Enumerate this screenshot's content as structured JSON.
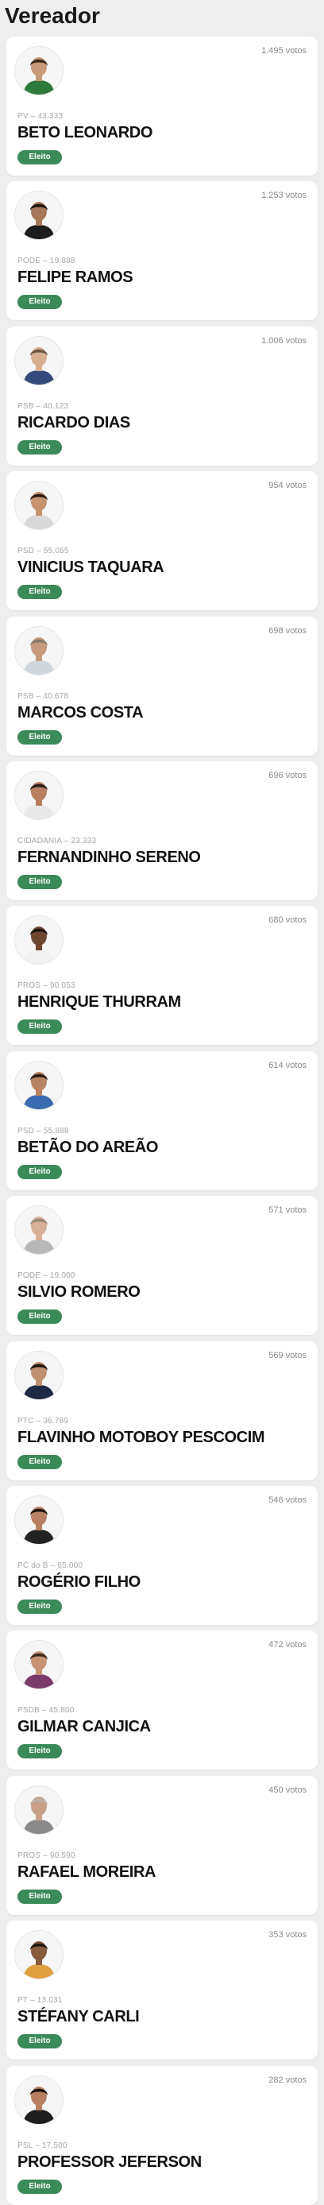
{
  "page": {
    "title": "Vereador",
    "badge_color": "#3a8a5a"
  },
  "candidates": [
    {
      "name": "BETO LEONARDO",
      "party": "PV – 43.333",
      "votes": "1.495 votos",
      "status": "Eleito",
      "skin": "#c89a78",
      "hair": "#3a2a20",
      "shirt": "#2e7a3a"
    },
    {
      "name": "FELIPE RAMOS",
      "party": "PODE – 19.888",
      "votes": "1.253 votos",
      "status": "Eleito",
      "skin": "#a8785a",
      "hair": "#1d1612",
      "shirt": "#1d1d1d"
    },
    {
      "name": "RICARDO DIAS",
      "party": "PSB – 40.123",
      "votes": "1.006 votos",
      "status": "Eleito",
      "skin": "#d8ad90",
      "hair": "#6d5846",
      "shirt": "#334a7a"
    },
    {
      "name": "VINICIUS TAQUARA",
      "party": "PSD – 55.055",
      "votes": "954 votos",
      "status": "Eleito",
      "skin": "#c8946e",
      "hair": "#2a1d16",
      "shirt": "#d8d8d8"
    },
    {
      "name": "MARCOS COSTA",
      "party": "PSB – 40.678",
      "votes": "698 votos",
      "status": "Eleito",
      "skin": "#c89a7c",
      "hair": "#8b7a6a",
      "shirt": "#cfd6dc"
    },
    {
      "name": "FERNANDINHO SERENO",
      "party": "CIDADANIA – 23.333",
      "votes": "696 votos",
      "status": "Eleito",
      "skin": "#b98060",
      "hair": "#2d1f17",
      "shirt": "#e8e8e8"
    },
    {
      "name": "HENRIQUE THURRAM",
      "party": "PROS – 90.053",
      "votes": "680 votos",
      "status": "Eleito",
      "skin": "#6e4632",
      "hair": "#1a120d",
      "shirt": "#f2f2f2"
    },
    {
      "name": "BETÃO DO AREÃO",
      "party": "PSD – 55.888",
      "votes": "614 votos",
      "status": "Eleito",
      "skin": "#b88462",
      "hair": "#2a1d16",
      "shirt": "#3a6ab0"
    },
    {
      "name": "SILVIO ROMERO",
      "party": "PODE – 19.000",
      "votes": "571 votos",
      "status": "Eleito",
      "skin": "#d8b096",
      "hair": "#9a8a7a",
      "shirt": "#b8b8b8"
    },
    {
      "name": "FLAVINHO MOTOBOY PESCOCIM",
      "party": "PTC – 36.789",
      "votes": "569 votos",
      "status": "Eleito",
      "skin": "#c09070",
      "hair": "#1f1611",
      "shirt": "#1e2a44"
    },
    {
      "name": "ROGÉRIO FILHO",
      "party": "PC do B – 65.000",
      "votes": "546 votos",
      "status": "Eleito",
      "skin": "#b98064",
      "hair": "#1f1611",
      "shirt": "#222222"
    },
    {
      "name": "GILMAR CANJICA",
      "party": "PSDB – 45.800",
      "votes": "472 votos",
      "status": "Eleito",
      "skin": "#c89474",
      "hair": "#3a2a20",
      "shirt": "#7a3a6a"
    },
    {
      "name": "RAFAEL MOREIRA",
      "party": "PROS – 90.590",
      "votes": "450 votos",
      "status": "Eleito",
      "skin": "#c8a08a",
      "hair": "#b8b0a8",
      "shirt": "#8a8a8a"
    },
    {
      "name": "STÉFANY CARLI",
      "party": "PT – 13.031",
      "votes": "353 votos",
      "status": "Eleito",
      "skin": "#8a5a3c",
      "hair": "#1f1611",
      "shirt": "#e0a040"
    },
    {
      "name": "PROFESSOR JEFERSON",
      "party": "PSL – 17.500",
      "votes": "282 votos",
      "status": "Eleito",
      "skin": "#b88060",
      "hair": "#1a120d",
      "shirt": "#1e1e1e"
    }
  ]
}
